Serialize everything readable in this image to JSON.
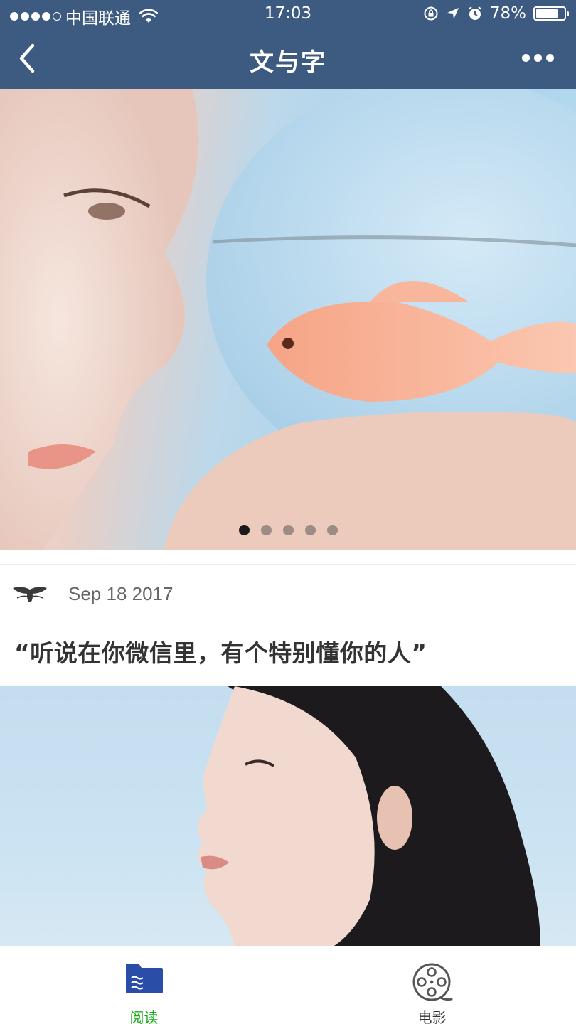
{
  "status_bar": {
    "carrier": "中国联通",
    "time": "17:03",
    "battery_percent_text": "78%",
    "battery_level": 0.78,
    "signal_bars_filled": 4,
    "signal_bars_total": 5,
    "icons": [
      "wifi-icon",
      "rotation-lock-icon",
      "location-arrow-icon",
      "alarm-icon",
      "battery-icon"
    ]
  },
  "nav": {
    "title": "文与字",
    "back_icon": "chevron-left-icon",
    "more_icon": "more-dots-icon",
    "background": "#3d5a80"
  },
  "carousel": {
    "page_count": 5,
    "active_index": 0,
    "active_dot_color": "#1a1a1a"
  },
  "post": {
    "date": "Sep 18 2017",
    "title": "“听说在你微信里，有个特别懂你的人”",
    "avatar_icon": "bee-icon"
  },
  "tab_bar": {
    "active_color": "#1aad19",
    "tabs": [
      {
        "label": "阅读",
        "icon": "reading-icon",
        "active": true
      },
      {
        "label": "电影",
        "icon": "film-reel-icon",
        "active": false
      }
    ]
  }
}
